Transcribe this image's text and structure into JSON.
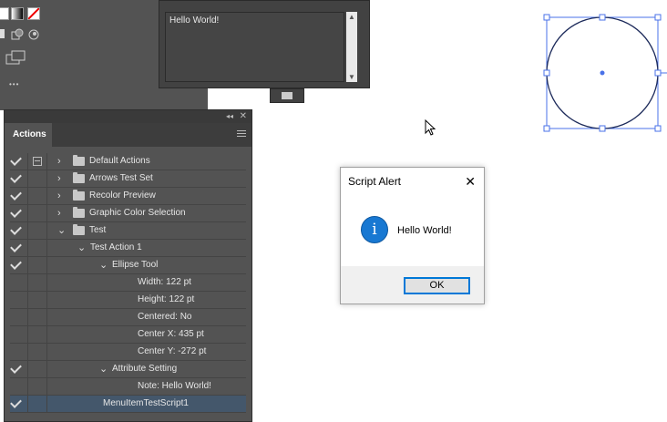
{
  "note_panel": {
    "text": "Hello World!"
  },
  "actions_panel": {
    "tab_label": "Actions",
    "collapse_glyph": "◂◂",
    "close_glyph": "✕",
    "rows": [
      {
        "label": "Default Actions",
        "level": 0,
        "chevron": "›",
        "folder": true,
        "toggle": true
      },
      {
        "label": "Arrows Test Set",
        "level": 0,
        "chevron": "›",
        "folder": true
      },
      {
        "label": "Recolor Preview",
        "level": 0,
        "chevron": "›",
        "folder": true
      },
      {
        "label": "Graphic Color Selection",
        "level": 0,
        "chevron": "›",
        "folder": true
      },
      {
        "label": "Test",
        "level": 0,
        "chevron": "⌄",
        "folder": true
      },
      {
        "label": "Test Action 1",
        "level": 1,
        "chevron": "⌄"
      },
      {
        "label": "Ellipse Tool",
        "level": 2,
        "chevron": "⌄"
      },
      {
        "label": "Width: 122 pt",
        "level": 3,
        "check": false
      },
      {
        "label": "Height: 122 pt",
        "level": 3,
        "check": false
      },
      {
        "label": "Centered: No",
        "level": 3,
        "check": false
      },
      {
        "label": "Center X: 435 pt",
        "level": 3,
        "check": false
      },
      {
        "label": "Center Y: -272 pt",
        "level": 3,
        "check": false
      },
      {
        "label": "Attribute Setting",
        "level": 2,
        "chevron": "⌄"
      },
      {
        "label": "Note: Hello World!",
        "level": 3,
        "check": false
      },
      {
        "label": "MenuItemTestScript1",
        "level": 2,
        "selected": true
      }
    ]
  },
  "tools": {
    "more_glyph": "•••"
  },
  "dialog": {
    "title": "Script Alert",
    "close_glyph": "✕",
    "info_glyph": "i",
    "message": "Hello World!",
    "ok_label": "OK"
  },
  "colors": {
    "selection_blue": "#4a72e8",
    "dialog_accent": "#0078d7"
  }
}
